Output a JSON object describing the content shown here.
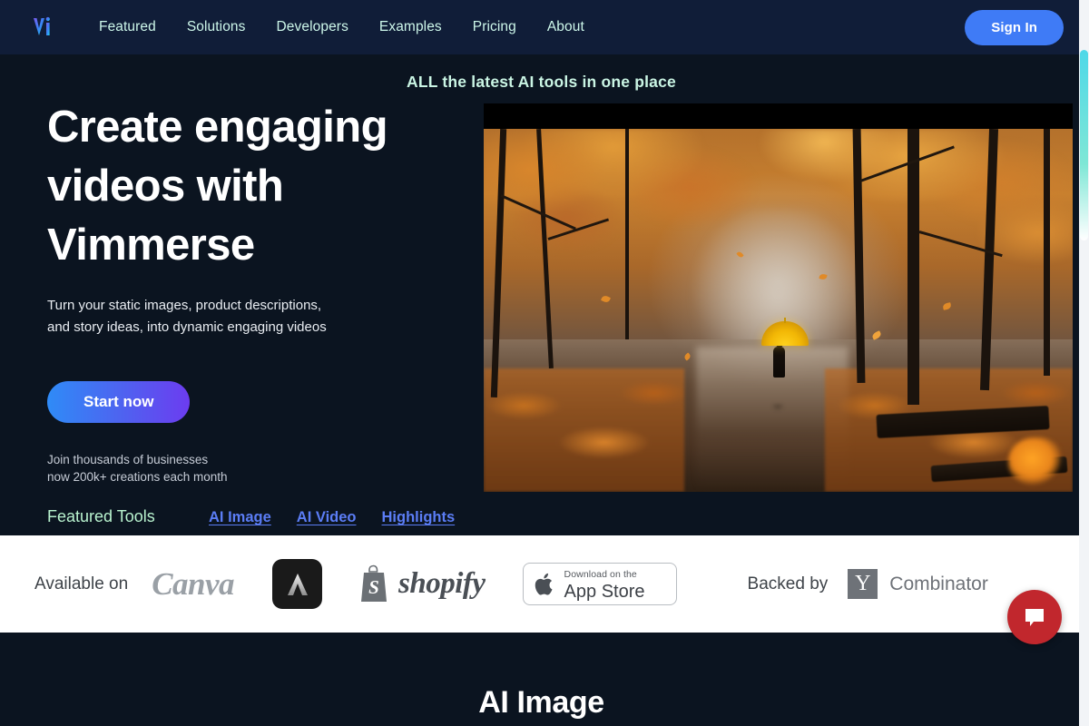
{
  "header": {
    "logo_text": "Vi",
    "logo_icon": "vimmerse-logo-icon",
    "nav": [
      {
        "label": "Featured"
      },
      {
        "label": "Solutions"
      },
      {
        "label": "Developers"
      },
      {
        "label": "Examples"
      },
      {
        "label": "Pricing"
      },
      {
        "label": "About"
      }
    ],
    "signin_label": "Sign In"
  },
  "hero": {
    "tagline": "ALL the latest AI tools in one place",
    "headline_line1_plain": "Create ",
    "headline_line1_highlight": "engaging",
    "headline_line2_highlight": "videos",
    "headline_line2_plain": " with",
    "headline_line3": "Vimmerse",
    "subtext_line1": "Turn your static images, product descriptions,",
    "subtext_line2": "and story ideas, into dynamic engaging videos",
    "cta_label": "Start now",
    "join_line1": "Join thousands of businesses",
    "join_line2": "now 200k+ creations each month",
    "tools_label": "Featured Tools",
    "tools": [
      {
        "label": "AI Image"
      },
      {
        "label": "AI Video"
      },
      {
        "label": "Highlights"
      }
    ],
    "image_alt": "autumn-forest-path-with-yellow-umbrella-video"
  },
  "partners": {
    "available_on_label": "Available on",
    "canva_label": "Canva",
    "adobe_icon": "adobe-express-icon",
    "shopify_icon": "shopify-bag-icon",
    "shopify_label": "shopify",
    "appstore_small": "Download on the",
    "appstore_big": "App Store",
    "appstore_icon": "apple-icon",
    "backed_by_label": "Backed by",
    "yc_mark": "Y",
    "yc_label": "Combinator"
  },
  "chat": {
    "icon": "chat-bubble-icon"
  },
  "lower": {
    "section_title": "AI Image"
  },
  "colors": {
    "header_bg": "#101d38",
    "page_bg": "#0b1420",
    "nav_link": "#cdf7ea",
    "signin_bg": "#3f7bf6",
    "brush_blue": "#2f6df0",
    "tool_link": "#5b7df5",
    "tools_label_green": "#b9f3cf",
    "cta_gradient_from": "#2f8bf7",
    "cta_gradient_to": "#6c3cf0",
    "chat_red": "#c1272d",
    "scrollbar_thumb": "#4fd8e8"
  }
}
